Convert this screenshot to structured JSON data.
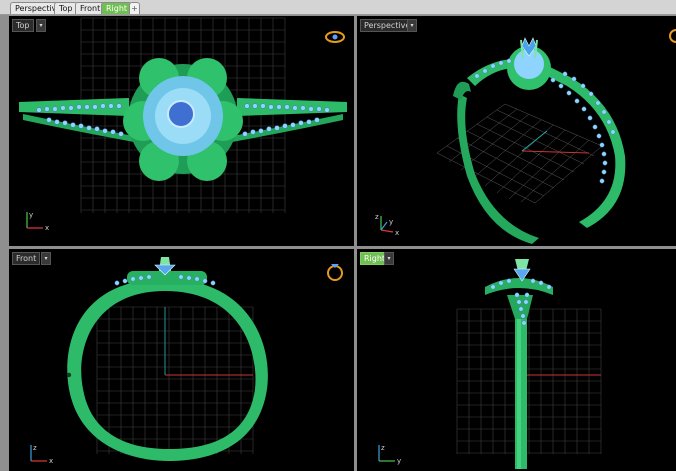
{
  "tabs": [
    {
      "label": "Perspective",
      "active": false
    },
    {
      "label": "Top",
      "active": false
    },
    {
      "label": "Front",
      "active": false
    },
    {
      "label": "Right",
      "active": true
    },
    {
      "label": "+",
      "active": false
    }
  ],
  "viewports": {
    "top": {
      "label": "Top",
      "dropdown": "▾"
    },
    "perspective": {
      "label": "Perspective",
      "dropdown": "▾"
    },
    "front": {
      "label": "Front",
      "dropdown": "▾"
    },
    "right": {
      "label": "Right",
      "dropdown": "▾"
    }
  },
  "axes": {
    "x": "x",
    "y": "y",
    "z": "z"
  },
  "colors": {
    "metal": "#2dbb6a",
    "metal_dark": "#1a7f45",
    "stone": "#8fd3ff",
    "grid": "#5a5a5a",
    "accent": "#6fbf53"
  },
  "icons": [
    "ring-icon",
    "axis-widget-icon"
  ]
}
